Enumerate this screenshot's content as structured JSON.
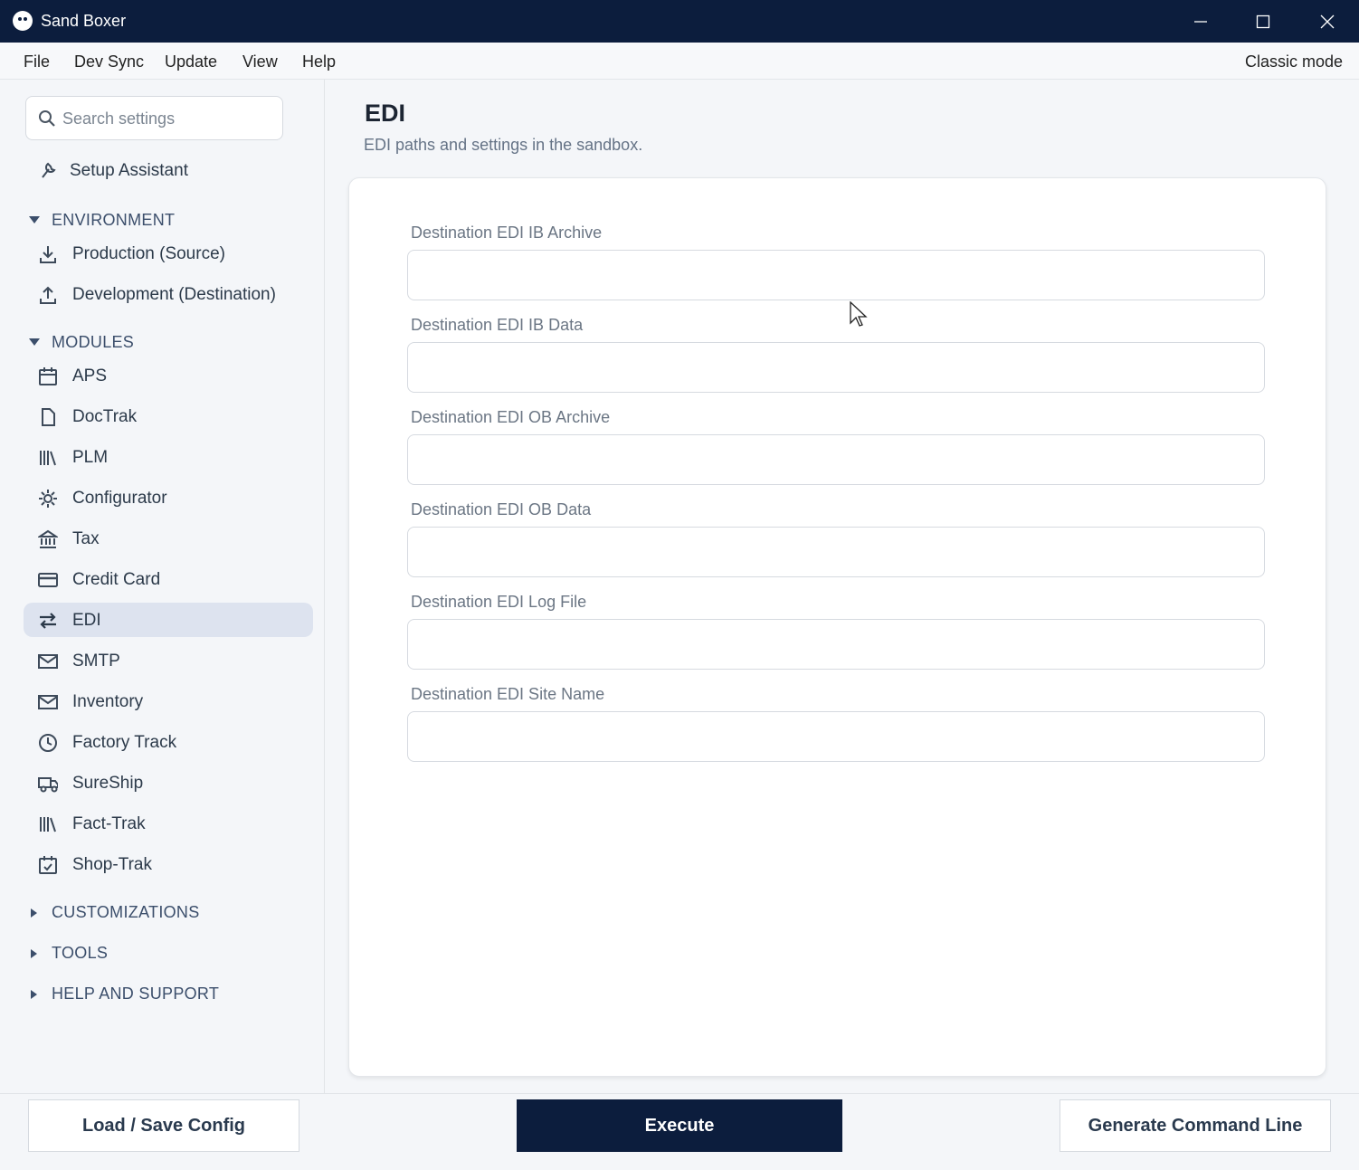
{
  "window": {
    "title": "Sand Boxer"
  },
  "menu": {
    "items": [
      "File",
      "Dev Sync",
      "Update",
      "View",
      "Help"
    ],
    "classic_mode": "Classic mode"
  },
  "sidebar": {
    "search_placeholder": "Search settings",
    "setup_assistant": "Setup Assistant",
    "environment": {
      "title": "ENVIRONMENT",
      "items": [
        "Production (Source)",
        "Development (Destination)"
      ]
    },
    "modules": {
      "title": "MODULES",
      "items": [
        "APS",
        "DocTrak",
        "PLM",
        "Configurator",
        "Tax",
        "Credit Card",
        "EDI",
        "SMTP",
        "Inventory",
        "Factory Track",
        "SureShip",
        "Fact-Trak",
        "Shop-Trak"
      ],
      "active": "EDI"
    },
    "collapsed_sections": [
      "CUSTOMIZATIONS",
      "TOOLS",
      "HELP AND SUPPORT"
    ]
  },
  "main": {
    "title": "EDI",
    "subtitle": "EDI paths and settings in the sandbox.",
    "fields": [
      {
        "label": "Destination EDI IB Archive",
        "value": ""
      },
      {
        "label": "Destination EDI IB Data",
        "value": ""
      },
      {
        "label": "Destination EDI OB Archive",
        "value": ""
      },
      {
        "label": "Destination EDI OB Data",
        "value": ""
      },
      {
        "label": "Destination EDI Log File",
        "value": ""
      },
      {
        "label": "Destination EDI Site Name",
        "value": ""
      }
    ]
  },
  "footer": {
    "load_save": "Load / Save Config",
    "execute": "Execute",
    "generate": "Generate Command Line"
  },
  "colors": {
    "primary": "#0c1d3d",
    "active_nav": "#dde3ef"
  }
}
